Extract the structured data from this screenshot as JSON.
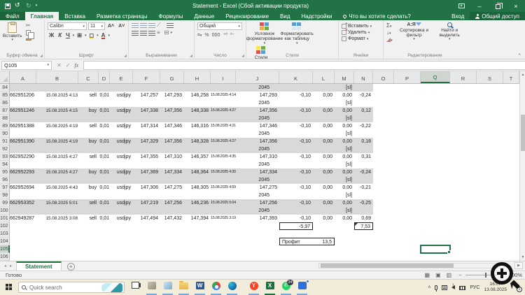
{
  "window": {
    "title": "Statement - Excel (Сбой активации продукта)"
  },
  "icons": [
    "save-icon",
    "undo-icon",
    "redo-icon",
    "customize-qat-icon",
    "ribbon-display-icon",
    "minimize-icon",
    "restore-icon",
    "close-icon",
    "lightbulb-icon",
    "person-icon",
    "search-icon",
    "magnifier-overlay-icon"
  ],
  "menu": {
    "file": "Файл",
    "tabs": [
      "Главная",
      "Вставка",
      "Разметка страницы",
      "Формулы",
      "Данные",
      "Рецензирование",
      "Вид",
      "Надстройки"
    ],
    "active_tab": "Главная",
    "tell_me": "Что вы хотите сделать?",
    "sign_in": "Вход",
    "share": "Общий доступ"
  },
  "ribbon": {
    "paste": "Вставить",
    "font_name": "Calibri",
    "font_size": "11",
    "bold": "Ж",
    "italic": "К",
    "underline": "Ч",
    "font_color_letter": "А",
    "number_format": "Общий",
    "styles": {
      "conditional": "Условное форматирование",
      "format_table": "Форматировать как таблицу",
      "cell_styles": "Стили ячеек"
    },
    "cells": {
      "insert": "Вставить",
      "delete": "Удалить",
      "format": "Формат"
    },
    "editing": {
      "sum": "Σ",
      "sort": "Сортировка и фильтр",
      "find": "Найти и выделить",
      "sort_letters": "А:Я"
    },
    "groups": {
      "clipboard": "Буфер обмена",
      "font": "Шрифт",
      "alignment": "Выравнивание",
      "number": "Число",
      "styles": "Стили",
      "cells": "Ячейки",
      "editing": "Редактирование"
    }
  },
  "formula_bar": {
    "name_box": "Q105",
    "fx": "fx",
    "formula": ""
  },
  "grid": {
    "columns": [
      "A",
      "B",
      "C",
      "D",
      "E",
      "F",
      "G",
      "H",
      "I",
      "J",
      "K",
      "L",
      "M",
      "N",
      "O",
      "P",
      "Q",
      "R",
      "S",
      "T"
    ],
    "selection": {
      "row": 105,
      "col": "Q"
    },
    "rows": [
      {
        "n": 84,
        "shade": true,
        "cells": [
          {
            "c": "J",
            "v": "2045",
            "k": "sep"
          },
          {
            "c": "M",
            "v": "[sl]"
          }
        ]
      },
      {
        "n": 85,
        "shade": false,
        "cells": [
          {
            "c": "A",
            "v": "662951206"
          },
          {
            "c": "B",
            "v": "15.08.2025 4:13"
          },
          {
            "c": "C",
            "v": "sell"
          },
          {
            "c": "D",
            "v": "0,01"
          },
          {
            "c": "E",
            "v": "usdjpy"
          },
          {
            "c": "F",
            "v": "147,257"
          },
          {
            "c": "G",
            "v": "147,293"
          },
          {
            "c": "H",
            "v": "146,258"
          },
          {
            "c": "I",
            "v": "15.08.2025 4:14"
          },
          {
            "c": "J",
            "v": "147,293"
          },
          {
            "c": "K",
            "v": "-0,10"
          },
          {
            "c": "L",
            "v": "0,00"
          },
          {
            "c": "M",
            "v": "0,00"
          },
          {
            "c": "N",
            "v": "-0,24"
          }
        ]
      },
      {
        "n": 86,
        "shade": false,
        "cells": [
          {
            "c": "J",
            "v": "2045",
            "k": "sep"
          },
          {
            "c": "M",
            "v": "[sl]"
          }
        ]
      },
      {
        "n": 87,
        "shade": true,
        "cells": [
          {
            "c": "A",
            "v": "662951246"
          },
          {
            "c": "B",
            "v": "15.08.2025 4:15"
          },
          {
            "c": "C",
            "v": "buy"
          },
          {
            "c": "D",
            "v": "0,01"
          },
          {
            "c": "E",
            "v": "usdjpy"
          },
          {
            "c": "F",
            "v": "147,338"
          },
          {
            "c": "G",
            "v": "147,356"
          },
          {
            "c": "H",
            "v": "148,338"
          },
          {
            "c": "I",
            "v": "15.08.2025 4:27"
          },
          {
            "c": "J",
            "v": "147,356"
          },
          {
            "c": "K",
            "v": "-0,10"
          },
          {
            "c": "L",
            "v": "0,00"
          },
          {
            "c": "M",
            "v": "0,00"
          },
          {
            "c": "N",
            "v": "0,12"
          }
        ]
      },
      {
        "n": 88,
        "shade": true,
        "cells": [
          {
            "c": "J",
            "v": "2045",
            "k": "sep"
          },
          {
            "c": "M",
            "v": "[sl]"
          }
        ]
      },
      {
        "n": 89,
        "shade": false,
        "cells": [
          {
            "c": "A",
            "v": "662951388"
          },
          {
            "c": "B",
            "v": "15.08.2025 4:19"
          },
          {
            "c": "C",
            "v": "sell"
          },
          {
            "c": "D",
            "v": "0,01"
          },
          {
            "c": "E",
            "v": "usdjpy"
          },
          {
            "c": "F",
            "v": "147,314"
          },
          {
            "c": "G",
            "v": "147,346"
          },
          {
            "c": "H",
            "v": "146,316"
          },
          {
            "c": "I",
            "v": "15.08.2025 4:21"
          },
          {
            "c": "J",
            "v": "147,346"
          },
          {
            "c": "K",
            "v": "-0,10"
          },
          {
            "c": "L",
            "v": "0,00"
          },
          {
            "c": "M",
            "v": "0,00"
          },
          {
            "c": "N",
            "v": "-0,22"
          }
        ]
      },
      {
        "n": 90,
        "shade": false,
        "cells": [
          {
            "c": "J",
            "v": "2045",
            "k": "sep"
          },
          {
            "c": "M",
            "v": "[sl]"
          }
        ]
      },
      {
        "n": 91,
        "shade": true,
        "cells": [
          {
            "c": "A",
            "v": "662951390"
          },
          {
            "c": "B",
            "v": "15.08.2025 4:19"
          },
          {
            "c": "C",
            "v": "buy"
          },
          {
            "c": "D",
            "v": "0,01"
          },
          {
            "c": "E",
            "v": "usdjpy"
          },
          {
            "c": "F",
            "v": "147,329"
          },
          {
            "c": "G",
            "v": "147,356"
          },
          {
            "c": "H",
            "v": "148,328"
          },
          {
            "c": "I",
            "v": "15.08.2025 4:27"
          },
          {
            "c": "J",
            "v": "147,356"
          },
          {
            "c": "K",
            "v": "-0,10"
          },
          {
            "c": "L",
            "v": "0,00"
          },
          {
            "c": "M",
            "v": "0,00"
          },
          {
            "c": "N",
            "v": "0,18"
          }
        ]
      },
      {
        "n": 92,
        "shade": true,
        "cells": [
          {
            "c": "J",
            "v": "2045",
            "k": "sep"
          },
          {
            "c": "M",
            "v": "[sl]"
          }
        ]
      },
      {
        "n": 93,
        "shade": false,
        "cells": [
          {
            "c": "A",
            "v": "662952290"
          },
          {
            "c": "B",
            "v": "15.08.2025 4:27"
          },
          {
            "c": "C",
            "v": "sell"
          },
          {
            "c": "D",
            "v": "0,01"
          },
          {
            "c": "E",
            "v": "usdjpy"
          },
          {
            "c": "F",
            "v": "147,355"
          },
          {
            "c": "G",
            "v": "147,310"
          },
          {
            "c": "H",
            "v": "146,357"
          },
          {
            "c": "I",
            "v": "15.08.2025 4:35"
          },
          {
            "c": "J",
            "v": "147,310"
          },
          {
            "c": "K",
            "v": "-0,10"
          },
          {
            "c": "L",
            "v": "0,00"
          },
          {
            "c": "M",
            "v": "0,00"
          },
          {
            "c": "N",
            "v": "0,31"
          }
        ]
      },
      {
        "n": 94,
        "shade": false,
        "cells": [
          {
            "c": "J",
            "v": "2045",
            "k": "sep"
          },
          {
            "c": "M",
            "v": "[sl]"
          }
        ]
      },
      {
        "n": 95,
        "shade": true,
        "cells": [
          {
            "c": "A",
            "v": "662952293"
          },
          {
            "c": "B",
            "v": "15.08.2025 4:27"
          },
          {
            "c": "C",
            "v": "buy"
          },
          {
            "c": "D",
            "v": "0,01"
          },
          {
            "c": "E",
            "v": "usdjpy"
          },
          {
            "c": "F",
            "v": "147,369"
          },
          {
            "c": "G",
            "v": "147,334"
          },
          {
            "c": "H",
            "v": "148,364"
          },
          {
            "c": "I",
            "v": "15.08.2025 4:30"
          },
          {
            "c": "J",
            "v": "147,334"
          },
          {
            "c": "K",
            "v": "-0,10"
          },
          {
            "c": "L",
            "v": "0,00"
          },
          {
            "c": "M",
            "v": "0,00"
          },
          {
            "c": "N",
            "v": "-0,24"
          }
        ]
      },
      {
        "n": 96,
        "shade": true,
        "cells": [
          {
            "c": "J",
            "v": "2045",
            "k": "sep"
          },
          {
            "c": "M",
            "v": "[sl]"
          }
        ]
      },
      {
        "n": 97,
        "shade": false,
        "cells": [
          {
            "c": "A",
            "v": "662952694"
          },
          {
            "c": "B",
            "v": "15.08.2025 4:43"
          },
          {
            "c": "C",
            "v": "buy"
          },
          {
            "c": "D",
            "v": "0,01"
          },
          {
            "c": "E",
            "v": "usdjpy"
          },
          {
            "c": "F",
            "v": "147,306"
          },
          {
            "c": "G",
            "v": "147,275"
          },
          {
            "c": "H",
            "v": "148,305"
          },
          {
            "c": "I",
            "v": "15.08.2025 4:59"
          },
          {
            "c": "J",
            "v": "147,275"
          },
          {
            "c": "K",
            "v": "-0,10"
          },
          {
            "c": "L",
            "v": "0,00"
          },
          {
            "c": "M",
            "v": "0,00"
          },
          {
            "c": "N",
            "v": "-0,21"
          }
        ]
      },
      {
        "n": 98,
        "shade": false,
        "cells": [
          {
            "c": "J",
            "v": "2045",
            "k": "sep"
          },
          {
            "c": "M",
            "v": "[sl]"
          }
        ]
      },
      {
        "n": 99,
        "shade": true,
        "cells": [
          {
            "c": "A",
            "v": "662953352"
          },
          {
            "c": "B",
            "v": "15.08.2025 5:01"
          },
          {
            "c": "C",
            "v": "sell"
          },
          {
            "c": "D",
            "v": "0,01"
          },
          {
            "c": "E",
            "v": "usdjpy"
          },
          {
            "c": "F",
            "v": "147,219"
          },
          {
            "c": "G",
            "v": "147,256"
          },
          {
            "c": "H",
            "v": "146,236"
          },
          {
            "c": "I",
            "v": "15.08.2025 5:04"
          },
          {
            "c": "J",
            "v": "147,256"
          },
          {
            "c": "K",
            "v": "-0,10"
          },
          {
            "c": "L",
            "v": "0,00"
          },
          {
            "c": "M",
            "v": "0,00"
          },
          {
            "c": "N",
            "v": "-0,25"
          }
        ]
      },
      {
        "n": 100,
        "shade": true,
        "cells": [
          {
            "c": "J",
            "v": "2045",
            "k": "sep"
          },
          {
            "c": "M",
            "v": "[sl]"
          }
        ]
      },
      {
        "n": 101,
        "shade": false,
        "cells": [
          {
            "c": "A",
            "v": "662949287"
          },
          {
            "c": "B",
            "v": "15.08.2025 3:08"
          },
          {
            "c": "C",
            "v": "sell"
          },
          {
            "c": "D",
            "v": "0,01"
          },
          {
            "c": "E",
            "v": "usdjpy"
          },
          {
            "c": "F",
            "v": "147,494"
          },
          {
            "c": "G",
            "v": "147,432"
          },
          {
            "c": "H",
            "v": "147,394"
          },
          {
            "c": "I",
            "v": "15.08.2025 3:19"
          },
          {
            "c": "J",
            "v": "147,393"
          },
          {
            "c": "K",
            "v": "-0,10"
          },
          {
            "c": "L",
            "v": "0,00"
          },
          {
            "c": "M",
            "v": "0,00"
          },
          {
            "c": "N",
            "v": "0,69"
          }
        ]
      },
      {
        "n": 102,
        "shade": false,
        "cells": [
          {
            "c": "K",
            "v": "-5,97",
            "k": "box"
          },
          {
            "c": "N",
            "v": "7,53",
            "k": "boxc"
          }
        ]
      },
      {
        "n": 103,
        "shade": false,
        "cells": []
      },
      {
        "n": 104,
        "shade": false,
        "cells": [
          {
            "c": "K",
            "v": "Профит",
            "k": "boxl"
          },
          {
            "c": "L",
            "v": "13,5",
            "k": "boxr"
          }
        ]
      },
      {
        "n": 105,
        "shade": false,
        "cells": []
      },
      {
        "n": 106,
        "shade": false,
        "cells": []
      }
    ]
  },
  "sheet_tabs": {
    "active": "Statement"
  },
  "status_bar": {
    "mode": "Готово",
    "zoom": "100%"
  },
  "taskbar": {
    "search_placeholder": "Quick search",
    "whatsapp_badge": "34",
    "word_letter": "W",
    "excel_letter": "X",
    "yandex_letter": "Y",
    "whatsapp_glyph": "✆",
    "tray": {
      "lang": "РУС",
      "time": "16:07",
      "date": "13.08.2025",
      "notification": "1"
    }
  }
}
